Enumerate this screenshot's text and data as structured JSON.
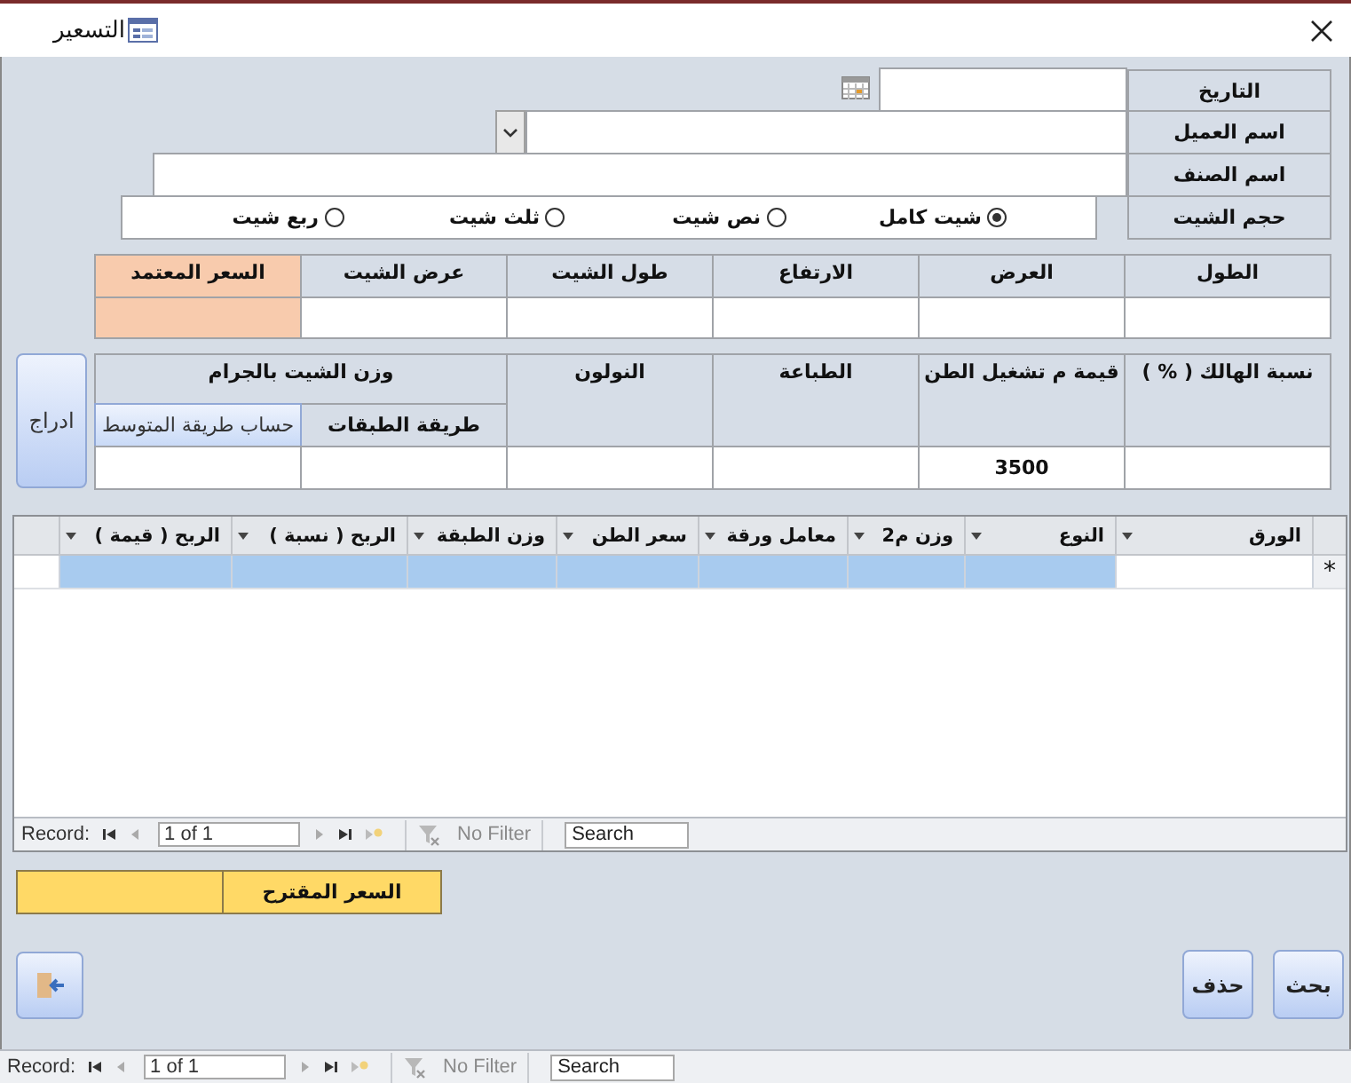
{
  "window": {
    "title": "التسعير"
  },
  "fields": [
    {
      "label": "التاريخ",
      "kind": "date"
    },
    {
      "label": "اسم العميل",
      "kind": "combo"
    },
    {
      "label": "اسم الصنف",
      "kind": "text"
    }
  ],
  "sheet_size": {
    "label": "حجم الشيت",
    "options": [
      {
        "label": "شيت كامل",
        "selected": true
      },
      {
        "label": "نص شيت",
        "selected": false
      },
      {
        "label": "ثلث شيت",
        "selected": false
      },
      {
        "label": "ربع شيت",
        "selected": false
      }
    ]
  },
  "dimensions": {
    "columns": [
      {
        "label": "الطول",
        "highlighted": false
      },
      {
        "label": "العرض",
        "highlighted": false
      },
      {
        "label": "الارتفاع",
        "highlighted": false
      },
      {
        "label": "طول الشيت",
        "highlighted": false
      },
      {
        "label": "عرض الشيت",
        "highlighted": false
      },
      {
        "label": "السعر المعتمد",
        "highlighted": true
      }
    ]
  },
  "costs": {
    "columns": [
      {
        "label": "نسبة الهالك ( % )"
      },
      {
        "label": "قيمة م تشغيل الطن",
        "value": "3500"
      },
      {
        "label": "الطباعة"
      },
      {
        "label": "النولون"
      }
    ],
    "weight": {
      "label": "وزن الشيت بالجرام",
      "method_label": "طريقة الطبقات",
      "average_button": "حساب طريقة المتوسط"
    }
  },
  "insert_button": "ادراج",
  "datasheet": {
    "columns": [
      "الورق",
      "النوع",
      "وزن م2",
      "معامل ورقة",
      "سعر  الطن",
      "وزن الطبقة",
      "الربح ( نسبة )",
      "الربح ( قيمة )"
    ],
    "new_row_marker": "*"
  },
  "record_navs": [
    {
      "label": "Record:",
      "position": "1 of 1",
      "filter": "No Filter",
      "placeholder": "Search"
    },
    {
      "label": "Record:",
      "position": "1 of 1",
      "filter": "No Filter",
      "placeholder": "Search"
    }
  ],
  "suggested_price": {
    "label": "السعر المقترح"
  },
  "buttons": [
    "بحث",
    "حذف"
  ]
}
